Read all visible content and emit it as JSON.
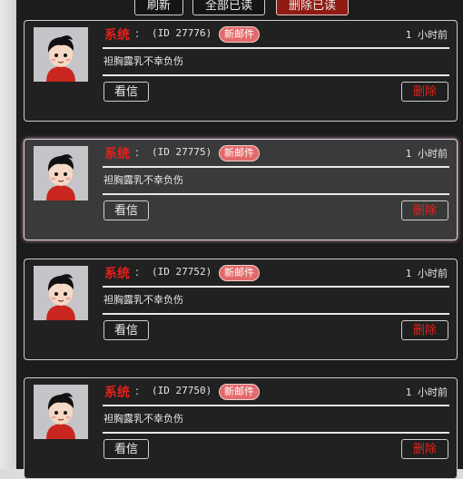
{
  "toolbar": {
    "refresh_label": "刷新",
    "mark_all_read_label": "全部已读",
    "delete_read_label": "删除已读"
  },
  "messages": [
    {
      "sender": "系统",
      "colon": ":",
      "id_text": "(ID 27776)",
      "badge": "新邮件",
      "time": "1 小时前",
      "body": "袒胸露乳不幸负伤",
      "read_label": "看信",
      "delete_label": "删除"
    },
    {
      "sender": "系统",
      "colon": ":",
      "id_text": "(ID 27775)",
      "badge": "新邮件",
      "time": "1 小时前",
      "body": "袒胸露乳不幸负伤",
      "read_label": "看信",
      "delete_label": "删除"
    },
    {
      "sender": "系统",
      "colon": ":",
      "id_text": "(ID 27752)",
      "badge": "新邮件",
      "time": "1 小时前",
      "body": "袒胸露乳不幸负伤",
      "read_label": "看信",
      "delete_label": "删除"
    },
    {
      "sender": "系统",
      "colon": ":",
      "id_text": "(ID 27750)",
      "badge": "新邮件",
      "time": "1 小时前",
      "body": "袒胸露乳不幸负伤",
      "read_label": "看信",
      "delete_label": "删除"
    }
  ],
  "icons": {
    "avatar": "cartoon-boy-avatar"
  },
  "colors": {
    "sender": "#e3211b",
    "badge": "#e36a6a",
    "danger_button": "#8f1b14",
    "panel": "#1c1c1c"
  }
}
